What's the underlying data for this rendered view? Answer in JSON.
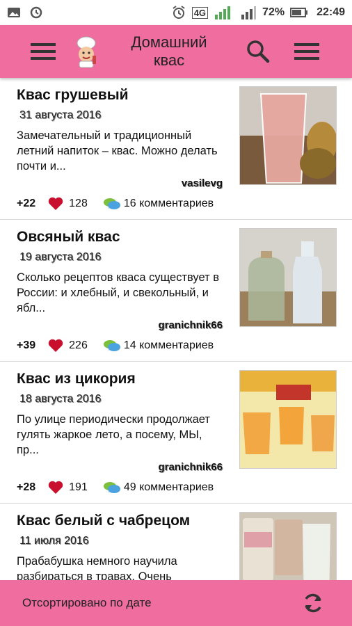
{
  "statusbar": {
    "icons_left": [
      "gallery-icon",
      "sync-icon"
    ],
    "network_label": "4G",
    "battery_percent": "72%",
    "time": "22:49"
  },
  "appbar": {
    "title_line1": "Домашний",
    "title_line2": "квас",
    "color": "#ef6e9f"
  },
  "recipes": [
    {
      "title": "Квас грушевый",
      "date": "31 августа 2016",
      "description": "Замечательный и традиционный летний напиток – квас. Можно делать почти и...",
      "author": "vasilevg",
      "rating": "+22",
      "likes": "128",
      "comments": "16 комментариев"
    },
    {
      "title": "Овсяный квас",
      "date": "19 августа 2016",
      "description": "Сколько рецептов кваса существует в России: и хлебный, и свекольный, и ябл...",
      "author": "granichnik66",
      "rating": "+39",
      "likes": "226",
      "comments": "14 комментариев"
    },
    {
      "title": "Квас из цикория",
      "date": "18 августа 2016",
      "description": "По улице периодически продолжает гулять жаркое лето, а посему, МЫ, пр...",
      "author": "granichnik66",
      "rating": "+28",
      "likes": "191",
      "comments": "49 комментариев"
    },
    {
      "title": "Квас белый с чабрецом",
      "date": "11 июля 2016",
      "description": "Прабабушка немного научила разбираться в травах. Очень",
      "author": "",
      "rating": "",
      "likes": "",
      "comments": ""
    }
  ],
  "bottombar": {
    "sort_label": "Отсортировано по дате"
  }
}
